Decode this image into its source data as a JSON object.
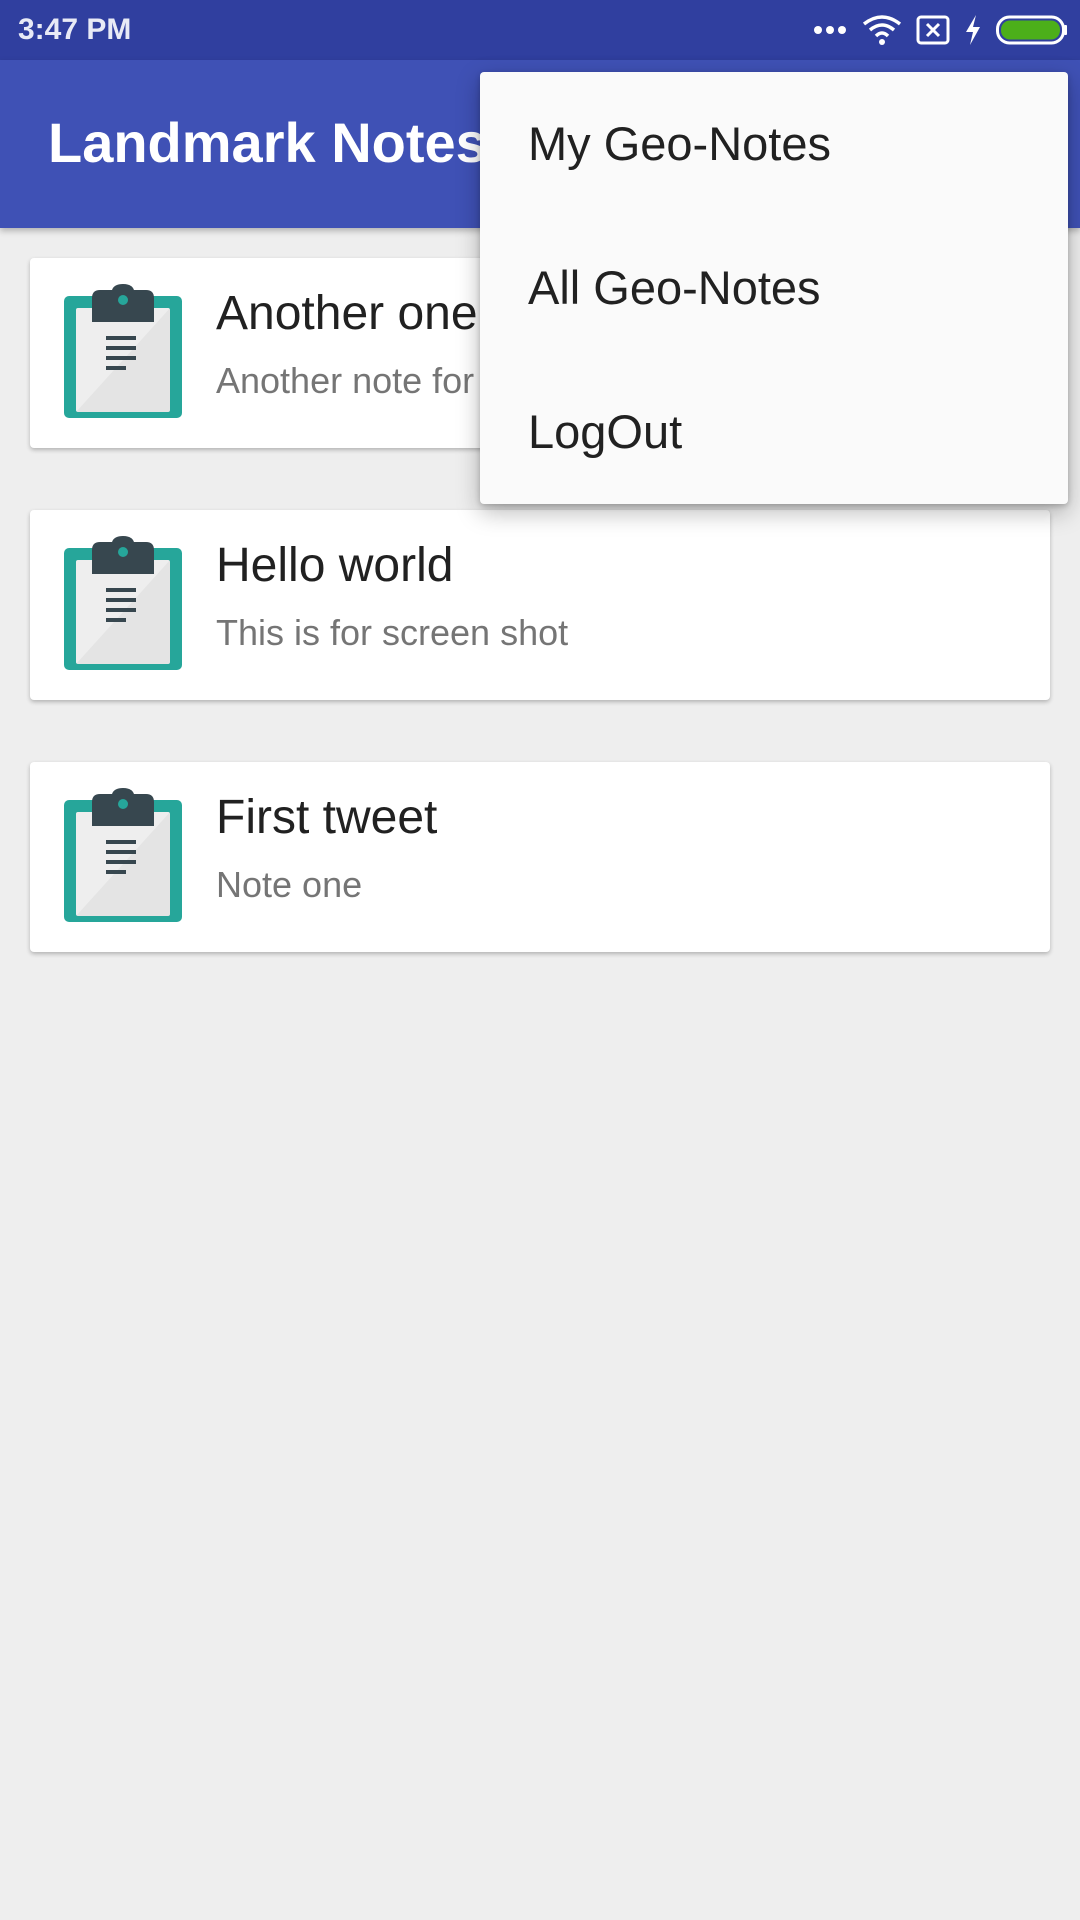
{
  "status_bar": {
    "time": "3:47 PM",
    "icons": [
      "more-dots-icon",
      "wifi-icon",
      "sim-off-icon",
      "charging-icon",
      "battery-full-icon"
    ],
    "battery_color": "#4caf1a"
  },
  "app_bar": {
    "title": "Landmark Notes",
    "color": "#3f51b5"
  },
  "notes": [
    {
      "title": "Another one",
      "description": "Another note for",
      "icon": "clipboard-icon"
    },
    {
      "title": "Hello world",
      "description": "This is for screen shot",
      "icon": "clipboard-icon"
    },
    {
      "title": "First tweet",
      "description": "Note one",
      "icon": "clipboard-icon"
    }
  ],
  "overflow_menu": {
    "items": [
      "My Geo-Notes",
      "All Geo-Notes",
      "LogOut"
    ]
  },
  "colors": {
    "accent_teal": "#26a69a",
    "primary_dark": "#303f9f",
    "background": "#eeeeee"
  }
}
